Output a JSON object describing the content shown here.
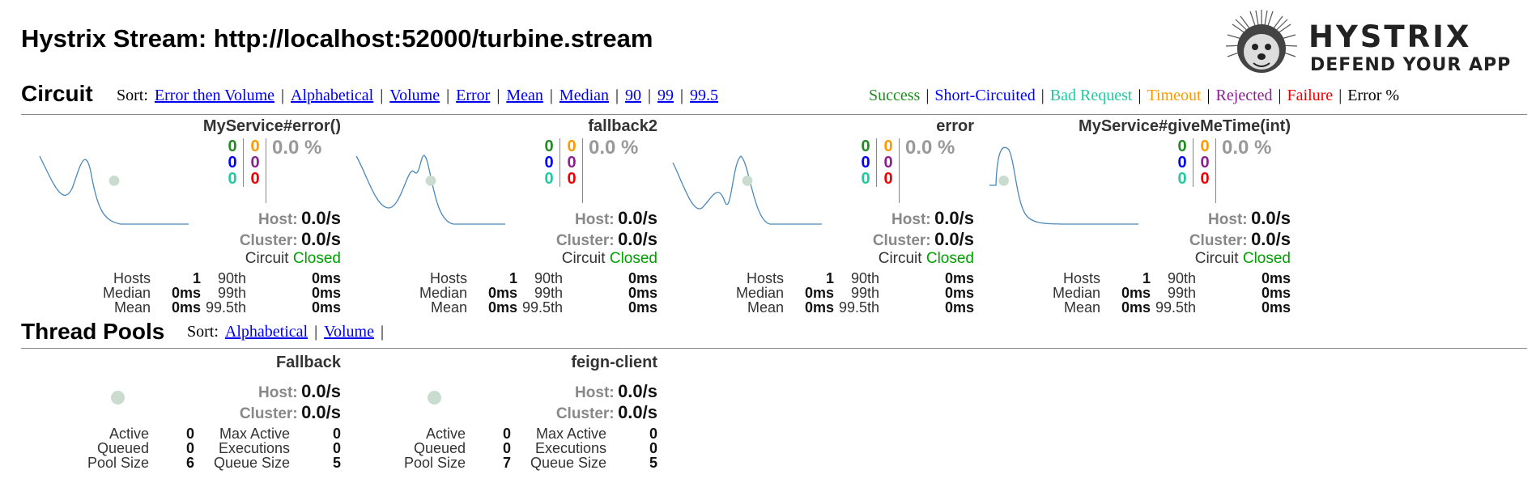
{
  "page_title": "Hystrix Stream: http://localhost:52000/turbine.stream",
  "logo": {
    "name": "HYSTRIX",
    "tagline": "DEFEND YOUR APP"
  },
  "circuit_section": {
    "title": "Circuit",
    "sort_label": "Sort:",
    "sort_options": [
      "Error then Volume",
      "Alphabetical",
      "Volume",
      "Error",
      "Mean",
      "Median",
      "90",
      "99",
      "99.5"
    ],
    "legend": [
      {
        "label": "Success",
        "color": "#228b22"
      },
      {
        "label": "Short-Circuited",
        "color": "#0000ff"
      },
      {
        "label": "Bad Request",
        "color": "#22c9a0"
      },
      {
        "label": "Timeout",
        "color": "#ff9900"
      },
      {
        "label": "Rejected",
        "color": "#8b2090"
      },
      {
        "label": "Failure",
        "color": "#ee0000"
      },
      {
        "label": "Error %",
        "color": "#000000"
      }
    ],
    "circuits": [
      {
        "name": "MyService#error()",
        "counts": {
          "success": "0",
          "short_circuited": "0",
          "bad_request": "0",
          "timeout": "0",
          "rejected": "0",
          "failure": "0"
        },
        "error_pct": "0.0 %",
        "host_label": "Host:",
        "host_rate": "0.0/s",
        "cluster_label": "Cluster:",
        "cluster_rate": "0.0/s",
        "circuit_label": "Circuit",
        "circuit_status": "Closed",
        "stats": {
          "hosts_label": "Hosts",
          "hosts": "1",
          "median_label": "Median",
          "median": "0ms",
          "mean_label": "Mean",
          "mean": "0ms",
          "p90_label": "90th",
          "p90": "0ms",
          "p99_label": "99th",
          "p99": "0ms",
          "p995_label": "99.5th",
          "p995": "0ms"
        }
      },
      {
        "name": "fallback2",
        "counts": {
          "success": "0",
          "short_circuited": "0",
          "bad_request": "0",
          "timeout": "0",
          "rejected": "0",
          "failure": "0"
        },
        "error_pct": "0.0 %",
        "host_label": "Host:",
        "host_rate": "0.0/s",
        "cluster_label": "Cluster:",
        "cluster_rate": "0.0/s",
        "circuit_label": "Circuit",
        "circuit_status": "Closed",
        "stats": {
          "hosts_label": "Hosts",
          "hosts": "1",
          "median_label": "Median",
          "median": "0ms",
          "mean_label": "Mean",
          "mean": "0ms",
          "p90_label": "90th",
          "p90": "0ms",
          "p99_label": "99th",
          "p99": "0ms",
          "p995_label": "99.5th",
          "p995": "0ms"
        }
      },
      {
        "name": "error",
        "counts": {
          "success": "0",
          "short_circuited": "0",
          "bad_request": "0",
          "timeout": "0",
          "rejected": "0",
          "failure": "0"
        },
        "error_pct": "0.0 %",
        "host_label": "Host:",
        "host_rate": "0.0/s",
        "cluster_label": "Cluster:",
        "cluster_rate": "0.0/s",
        "circuit_label": "Circuit",
        "circuit_status": "Closed",
        "stats": {
          "hosts_label": "Hosts",
          "hosts": "1",
          "median_label": "Median",
          "median": "0ms",
          "mean_label": "Mean",
          "mean": "0ms",
          "p90_label": "90th",
          "p90": "0ms",
          "p99_label": "99th",
          "p99": "0ms",
          "p995_label": "99.5th",
          "p995": "0ms"
        }
      },
      {
        "name": "MyService#giveMeTime(int)",
        "counts": {
          "success": "0",
          "short_circuited": "0",
          "bad_request": "0",
          "timeout": "0",
          "rejected": "0",
          "failure": "0"
        },
        "error_pct": "0.0 %",
        "host_label": "Host:",
        "host_rate": "0.0/s",
        "cluster_label": "Cluster:",
        "cluster_rate": "0.0/s",
        "circuit_label": "Circuit",
        "circuit_status": "Closed",
        "stats": {
          "hosts_label": "Hosts",
          "hosts": "1",
          "median_label": "Median",
          "median": "0ms",
          "mean_label": "Mean",
          "mean": "0ms",
          "p90_label": "90th",
          "p90": "0ms",
          "p99_label": "99th",
          "p99": "0ms",
          "p995_label": "99.5th",
          "p995": "0ms"
        }
      }
    ]
  },
  "threadpool_section": {
    "title": "Thread Pools",
    "sort_label": "Sort:",
    "sort_options": [
      "Alphabetical",
      "Volume"
    ],
    "pools": [
      {
        "name": "Fallback",
        "host_label": "Host:",
        "host_rate": "0.0/s",
        "cluster_label": "Cluster:",
        "cluster_rate": "0.0/s",
        "stats": {
          "active_label": "Active",
          "active": "0",
          "queued_label": "Queued",
          "queued": "0",
          "pool_size_label": "Pool Size",
          "pool_size": "6",
          "max_active_label": "Max Active",
          "max_active": "0",
          "executions_label": "Executions",
          "executions": "0",
          "queue_size_label": "Queue Size",
          "queue_size": "5"
        }
      },
      {
        "name": "feign-client",
        "host_label": "Host:",
        "host_rate": "0.0/s",
        "cluster_label": "Cluster:",
        "cluster_rate": "0.0/s",
        "stats": {
          "active_label": "Active",
          "active": "0",
          "queued_label": "Queued",
          "queued": "0",
          "pool_size_label": "Pool Size",
          "pool_size": "7",
          "max_active_label": "Max Active",
          "max_active": "0",
          "executions_label": "Executions",
          "executions": "0",
          "queue_size_label": "Queue Size",
          "queue_size": "5"
        }
      }
    ]
  }
}
